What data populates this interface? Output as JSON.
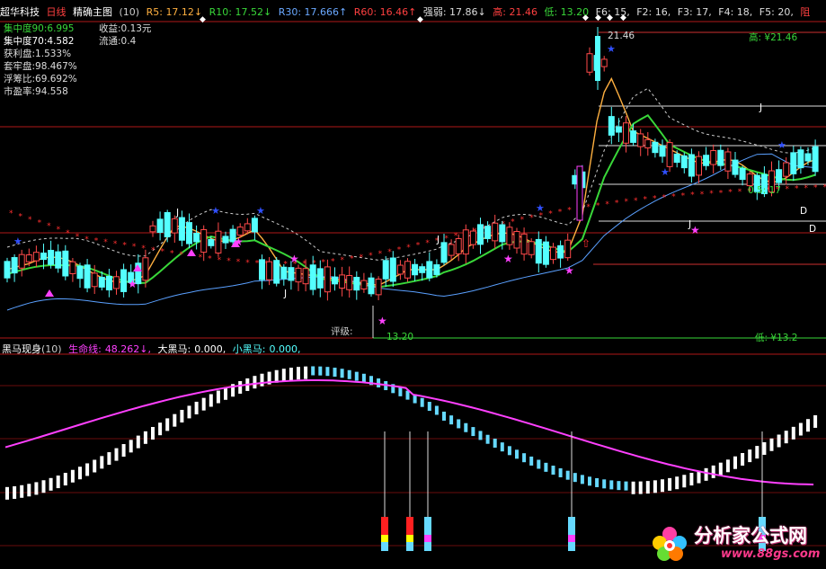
{
  "header": {
    "stock_name": "超华科技",
    "period": "日线",
    "main_indicator": "精确主图",
    "main_param": "(10)",
    "ma5": "R5: 17.12↓",
    "ma10": "R10: 17.52↓",
    "ma30": "R30: 17.666↑",
    "ma60": "R60: 16.46↑",
    "strong_weak": "强弱: 17.86↓",
    "high": "高: 21.46",
    "low": "低: 13.20",
    "f6": "F6: 15,",
    "f2": "F2: 16,",
    "f3": "F3: 17,",
    "f4": "F4: 18,",
    "f5": "F5: 20,",
    "resist": "阻"
  },
  "stats_left": [
    {
      "label": "集中度90:",
      "value": "6.995"
    },
    {
      "label": "集中度70:",
      "value": "4.582"
    },
    {
      "label": "获利盘:",
      "value": "1.533%"
    },
    {
      "label": "套牢盘:",
      "value": "98.467%"
    },
    {
      "label": "浮筹比:",
      "value": "69.692%"
    },
    {
      "label": "市盈率:",
      "value": "94.558"
    }
  ],
  "stats_right": [
    {
      "label": "收益:",
      "value": "0.13元"
    },
    {
      "label": "流通:",
      "value": "0.4"
    }
  ],
  "price_marks": {
    "peak": "21.46",
    "high_label": "高:",
    "high_value": "¥21.46",
    "rating_label": "评级:",
    "low_mark": "13.20",
    "low_label": "低:",
    "low_value": "¥13.2",
    "level": "0.5: 17",
    "j_label": "J",
    "d_label": "D"
  },
  "indicator": {
    "name": "黑马现身",
    "param": "(10)",
    "lifeline_label": "生命线:",
    "lifeline_value": "48.262↓,",
    "big_horse_label": "大黑马:",
    "big_horse_value": "0.000,",
    "small_horse_label": "小黑马:",
    "small_horse_value": "0.000,"
  },
  "watermark": {
    "text": "分析家公式网",
    "url": "www.88gs.com"
  },
  "colors": {
    "up": "#ff4a4a",
    "down": "#54ffff",
    "ma5": "#ffb040",
    "ma10": "#39d739",
    "ma30": "#5aa0ff",
    "ma60": "#ff3030",
    "lifeline": "#ff40ff",
    "axis": "#b01818"
  },
  "chart_data": [
    {
      "type": "candlestick",
      "title": "精确主图",
      "series": [
        {
          "name": "R5",
          "last": 17.12
        },
        {
          "name": "R10",
          "last": 17.52
        },
        {
          "name": "R30",
          "last": 17.666
        },
        {
          "name": "R60",
          "last": 16.46
        }
      ],
      "high": 21.46,
      "low": 13.2
    },
    {
      "type": "bar",
      "title": "黑马现身",
      "series": [
        {
          "name": "生命线",
          "last": 48.262
        },
        {
          "name": "大黑马",
          "last": 0
        },
        {
          "name": "小黑马",
          "last": 0
        }
      ]
    }
  ]
}
